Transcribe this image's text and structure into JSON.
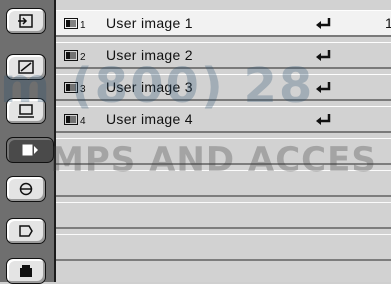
{
  "sidebar": {
    "buttons": [
      {
        "icon": "input-icon"
      },
      {
        "icon": "image-adjust-icon"
      },
      {
        "icon": "screen-size-icon"
      },
      {
        "icon": "user-image-icon",
        "active": true
      },
      {
        "icon": "color-icon"
      },
      {
        "icon": "sound-icon"
      },
      {
        "icon": "settings-icon"
      }
    ]
  },
  "menu": {
    "items": [
      {
        "number": "1",
        "label": "User image 1",
        "enter_icon": "enter-icon",
        "extra": "1"
      },
      {
        "number": "2",
        "label": "User image 2",
        "enter_icon": "enter-icon"
      },
      {
        "number": "3",
        "label": "User image 3",
        "enter_icon": "enter-icon"
      },
      {
        "number": "4",
        "label": "User image 4",
        "enter_icon": "enter-icon"
      }
    ]
  },
  "watermark": {
    "line1": "m (800) 28",
    "line2": "MPS AND ACCES"
  }
}
